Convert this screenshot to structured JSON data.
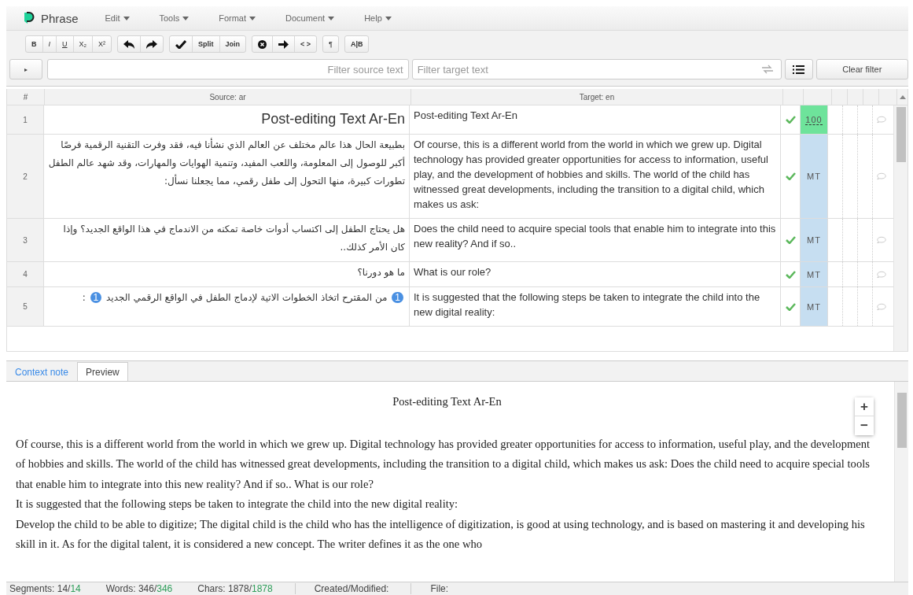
{
  "app": {
    "name": "Phrase"
  },
  "menu": [
    {
      "label": "Edit"
    },
    {
      "label": "Tools"
    },
    {
      "label": "Format"
    },
    {
      "label": "Document"
    },
    {
      "label": "Help"
    }
  ],
  "toolbar": [
    [
      {
        "kind": "text",
        "label": "B"
      },
      {
        "kind": "text",
        "label": "I"
      },
      {
        "kind": "text",
        "label": "U"
      },
      {
        "kind": "text",
        "label": "X₂"
      },
      {
        "kind": "text",
        "label": "X²"
      }
    ],
    [
      {
        "kind": "undo"
      },
      {
        "kind": "redo"
      }
    ],
    [
      {
        "kind": "check"
      },
      {
        "kind": "text",
        "label": "Split"
      },
      {
        "kind": "text",
        "label": "Join"
      }
    ],
    [
      {
        "kind": "cancel"
      },
      {
        "kind": "arrow"
      },
      {
        "kind": "text",
        "label": "< >"
      }
    ],
    [
      {
        "kind": "text",
        "label": "¶"
      }
    ],
    [
      {
        "kind": "text",
        "label": "A|B"
      }
    ]
  ],
  "filter": {
    "toggle": "▸",
    "source_placeholder": "Filter source text",
    "target_placeholder": "Filter target text",
    "clear": "Clear filter"
  },
  "table": {
    "columns": [
      "#",
      "Source: ar",
      "Target: en"
    ],
    "rows": [
      {
        "num": "1",
        "heading": true,
        "source": "Post-editing Text Ar-En",
        "target": "Post-editing Text Ar-En",
        "confirmed": true,
        "match": "100",
        "exact_match": true
      },
      {
        "num": "2",
        "heading": false,
        "source": "بطبيعة الحال هذا عالم مختلف عن العالم الذي نشأنا فيه، فقد وفرت التقنية الرقمية فرصًا أكبر للوصول إلى المعلومة، واللعب المفيد، وتنمية الهوايات والمهارات، وقد شهد عالم الطفل تطورات كبيرة، منها التحول إلى طفل رقمي، مما يجعلنا نسأل:",
        "target": "Of course, this is a different world from the world in which we grew up. Digital technology has provided greater opportunities for access to information, useful play, and the development of hobbies and skills. The world of the child has witnessed great developments, including the transition to a digital child, which makes us ask:",
        "confirmed": true,
        "match": "MT",
        "exact_match": false
      },
      {
        "num": "3",
        "heading": false,
        "source": "هل يحتاج الطفل إلى اكتساب أدوات خاصة تمكنه من الاندماج في هذا الواقع الجديد؟ وإذا كان الأمر كذلك..",
        "target": "Does the child need to acquire special tools that enable him to integrate into this new reality? And if so..",
        "confirmed": true,
        "match": "MT",
        "exact_match": false
      },
      {
        "num": "4",
        "heading": false,
        "source": "ما هو دورنا؟",
        "target": "What is our role?",
        "confirmed": true,
        "match": "MT",
        "exact_match": false
      },
      {
        "num": "5",
        "heading": false,
        "open_tag": "1",
        "source": "من المقترح اتخاذ الخطوات الاتية لإدماج الطفل في الواقع الرقمي الجديد",
        "close_tag": "1",
        "source_end": ":",
        "target": "It is suggested that the following steps be taken to integrate the child into the new digital reality:",
        "confirmed": true,
        "match": "MT",
        "exact_match": false
      }
    ]
  },
  "panel_tabs": [
    {
      "label": "Context note",
      "selected": false
    },
    {
      "label": "Preview",
      "selected": true
    }
  ],
  "preview": {
    "title": "Post-editing Text Ar-En",
    "zoom_in": "+",
    "zoom_out": "−",
    "paragraphs": [
      "Of course, this is a different world from the world in which we grew up. Digital technology has provided greater opportunities for access to information, useful play, and the development of hobbies and skills. The world of the child has witnessed great developments, including the transition to a digital child, which makes us ask: Does the child need to acquire special tools that enable him to integrate into this new reality? And if so.. What is our role?",
      "It is suggested that the following steps be taken to integrate the child into the new digital reality:",
      "Develop the child to be able to digitize; The digital child is the child who has the intelligence of digitization, is good at using technology, and is based on mastering it and developing his skill in it. As for the digital talent, it is considered a new concept. The writer defines it as the one who"
    ]
  },
  "status_bar": [
    {
      "label": "Segments:",
      "value": "14/",
      "done": "14"
    },
    {
      "label": "Words:",
      "value": "346/",
      "done": "346"
    },
    {
      "label": "Chars:",
      "value": "1878/",
      "done": "1878"
    },
    {
      "label": "Created/Modified:"
    },
    {
      "label": "File:"
    }
  ]
}
